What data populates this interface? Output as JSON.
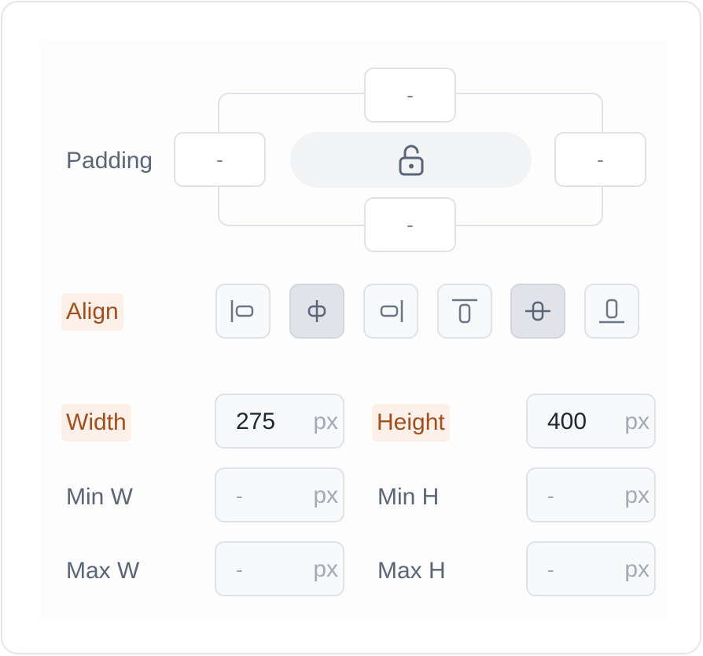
{
  "padding": {
    "label": "Padding",
    "top": "-",
    "left": "-",
    "right": "-",
    "bottom": "-",
    "lock_icon": "unlock-icon"
  },
  "align": {
    "label": "Align",
    "buttons": [
      {
        "name": "align-left-icon",
        "active": false
      },
      {
        "name": "align-center-horizontal-icon",
        "active": true
      },
      {
        "name": "align-right-icon",
        "active": false
      },
      {
        "name": "align-top-icon",
        "active": false
      },
      {
        "name": "align-center-vertical-icon",
        "active": true
      },
      {
        "name": "align-bottom-icon",
        "active": false
      }
    ]
  },
  "size": {
    "width_label": "Width",
    "width_value": "275",
    "height_label": "Height",
    "height_value": "400",
    "min_w_label": "Min W",
    "min_w_value": "-",
    "min_h_label": "Min H",
    "min_h_value": "-",
    "max_w_label": "Max W",
    "max_w_value": "-",
    "max_h_label": "Max H",
    "max_h_value": "-",
    "unit": "px"
  },
  "colors": {
    "highlight_bg": "#fdf0e8",
    "highlight_text": "#a0501f",
    "label_text": "#5a6678",
    "active_button": "#e1e3e8"
  }
}
